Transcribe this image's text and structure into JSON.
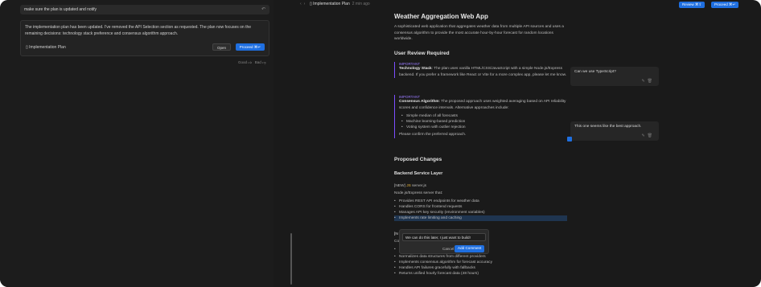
{
  "chat": {
    "prompt": "make sure the plan is updated and notify",
    "reply": "The implementation plan has been updated. I've removed the API Selection section as requested. The plan now focuses on the remaining decisions: technology stack preference and consensus algorithm approach.",
    "plan_link": "Implementation Plan",
    "open_label": "Open",
    "proceed_label": "Proceed ⌘↵",
    "feedback_good": "Good",
    "feedback_bad": "Bad"
  },
  "topbar": {
    "title": "Implementation Plan",
    "time": "2 min ago",
    "review_label": "Review ⌘⇧",
    "proceed_label": "Proceed ⌘↵"
  },
  "doc": {
    "title": "Weather Aggregation Web App",
    "intro": "A sophisticated web application that aggregates weather data from multiple API sources and uses a consensus algorithm to provide the most accurate hour-by-hour forecast for random locations worldwide.",
    "review_heading": "User Review Required",
    "alert1_tag": "IMPORTANT",
    "alert1_bold": "Technology Stack",
    "alert1_text": ": The plan uses vanilla HTML/CSS/JavaScript with a simple Node.js/Express backend. If you prefer a framework like React or Vite for a more complex app, please let me know.",
    "alert2_tag": "IMPORTANT",
    "alert2_bold": "Consensus Algorithm",
    "alert2_text": ": The proposed approach uses weighted averaging based on API reliability scores and confidence intervals. Alternative approaches include:",
    "alert2_items": [
      "Simple median of all forecasts",
      "Machine learning-based prediction",
      "Voting system with outlier rejection"
    ],
    "alert2_footer": "Please confirm the preferred approach.",
    "changes_heading": "Proposed Changes",
    "backend_heading": "Backend Service Layer",
    "new_tag": "[NEW]",
    "file_name": "server.js",
    "server_desc": "Node.js/Express server that:",
    "server_items": [
      "Provides REST API endpoints for weather data",
      "Handles CORS for frontend requests",
      "Manages API key security (environment variables)",
      "Implements rate limiting and caching"
    ],
    "next_tag": "[N",
    "next_desc": "Co",
    "agg_items": [
      "Normalizes data structures from different providers",
      "Implements consensus algorithm for forecast accuracy",
      "Handles API failures gracefully with fallbacks",
      "Returns unified hourly forecast data (48 hours)"
    ]
  },
  "comments": [
    {
      "text": "Can we use TypeScript?"
    },
    {
      "text": "This one seems like the best approach."
    }
  ],
  "popup": {
    "input_value": "We can do this later, I just want to build!",
    "cancel_label": "Cancel",
    "add_label": "Add Comment"
  }
}
